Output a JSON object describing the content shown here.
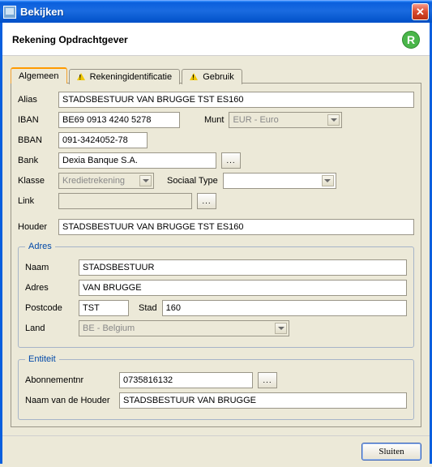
{
  "window": {
    "title": "Bekijken",
    "heading": "Rekening Opdrachtgever",
    "badge": "R"
  },
  "tabs": [
    {
      "label": "Algemeen",
      "warn": false,
      "active": true
    },
    {
      "label": "Rekeningidentificatie",
      "warn": true,
      "active": false
    },
    {
      "label": "Gebruik",
      "warn": true,
      "active": false
    }
  ],
  "labels": {
    "alias": "Alias",
    "iban": "IBAN",
    "munt": "Munt",
    "bban": "BBAN",
    "bank": "Bank",
    "klasse": "Klasse",
    "sociaal_type": "Sociaal Type",
    "link": "Link",
    "houder": "Houder",
    "adres_legend": "Adres",
    "naam": "Naam",
    "adres": "Adres",
    "postcode": "Postcode",
    "stad": "Stad",
    "land": "Land",
    "entiteit_legend": "Entiteit",
    "abonnementnr": "Abonnementnr",
    "naam_houder": "Naam van de Houder"
  },
  "fields": {
    "alias": "STADSBESTUUR VAN BRUGGE TST ES160",
    "iban": "BE69 0913 4240 5278",
    "munt": "EUR - Euro",
    "bban": "091-3424052-78",
    "bank": "Dexia Banque S.A.",
    "klasse": "Kredietrekening",
    "sociaal_type": "",
    "link": "",
    "houder": "STADSBESTUUR VAN BRUGGE TST ES160"
  },
  "adres": {
    "naam": "STADSBESTUUR",
    "adres": "VAN BRUGGE",
    "postcode": "TST",
    "stad": "160",
    "land": "BE - Belgium"
  },
  "entiteit": {
    "abonnementnr": "0735816132",
    "naam_houder": "STADSBESTUUR VAN BRUGGE"
  },
  "footer": {
    "close": "Sluiten"
  },
  "icons": {
    "dots": "..."
  }
}
